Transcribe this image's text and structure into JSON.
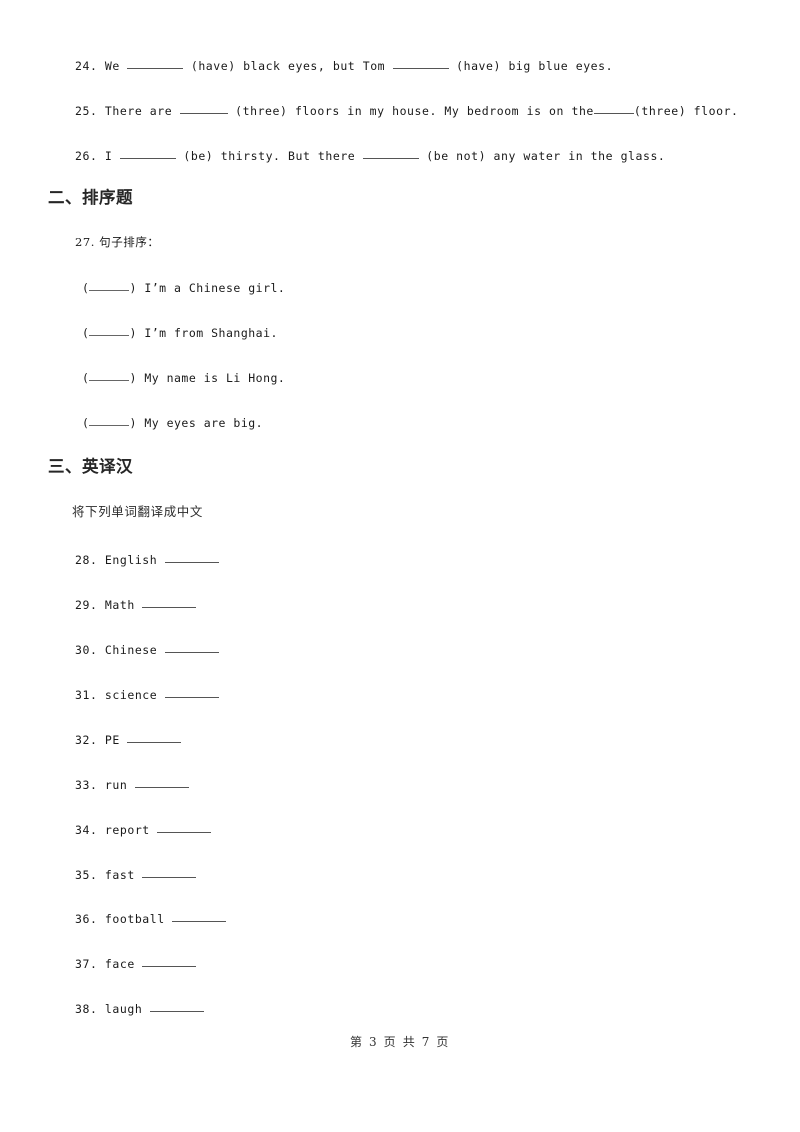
{
  "document": {
    "fill_blank_questions": [
      {
        "number": "24",
        "dot": ".",
        "seg1": "We",
        "seg2": "(have) black eyes, but Tom",
        "seg3": "(have) big blue eyes."
      },
      {
        "number": "25",
        "dot": ".",
        "seg1": "There are",
        "seg2": "(three) floors in my house. My bedroom is on the",
        "seg3": "(three) floor."
      },
      {
        "number": "26",
        "dot": ".",
        "seg1": "I",
        "seg2": "(be) thirsty. But there",
        "seg3": "(be not) any water in the glass."
      }
    ],
    "section_two": {
      "heading": "二、排序题",
      "question": {
        "number": "27",
        "dot": ".",
        "text": "句子排序："
      },
      "options": [
        {
          "prefix": "(",
          "suffix": ")",
          "text": "I’m a Chinese girl."
        },
        {
          "prefix": "(",
          "suffix": ")",
          "text": "I’m from Shanghai."
        },
        {
          "prefix": "(",
          "suffix": ")",
          "text": "My name is Li Hong."
        },
        {
          "prefix": "(",
          "suffix": ")",
          "text": "My eyes are big."
        }
      ]
    },
    "section_three": {
      "heading": "三、英译汉",
      "instruction": "将下列单词翻译成中文",
      "words": [
        {
          "number": "28",
          "dot": ".",
          "word": "English"
        },
        {
          "number": "29",
          "dot": ".",
          "word": "Math"
        },
        {
          "number": "30",
          "dot": ".",
          "word": "Chinese"
        },
        {
          "number": "31",
          "dot": ".",
          "word": "science"
        },
        {
          "number": "32",
          "dot": ".",
          "word": "PE"
        },
        {
          "number": "33",
          "dot": ".",
          "word": "run"
        },
        {
          "number": "34",
          "dot": ".",
          "word": "report"
        },
        {
          "number": "35",
          "dot": ".",
          "word": "fast"
        },
        {
          "number": "36",
          "dot": ".",
          "word": "football"
        },
        {
          "number": "37",
          "dot": ".",
          "word": "face"
        },
        {
          "number": "38",
          "dot": ".",
          "word": "laugh"
        }
      ]
    },
    "footer": {
      "text": "第 3 页 共 7 页"
    }
  }
}
